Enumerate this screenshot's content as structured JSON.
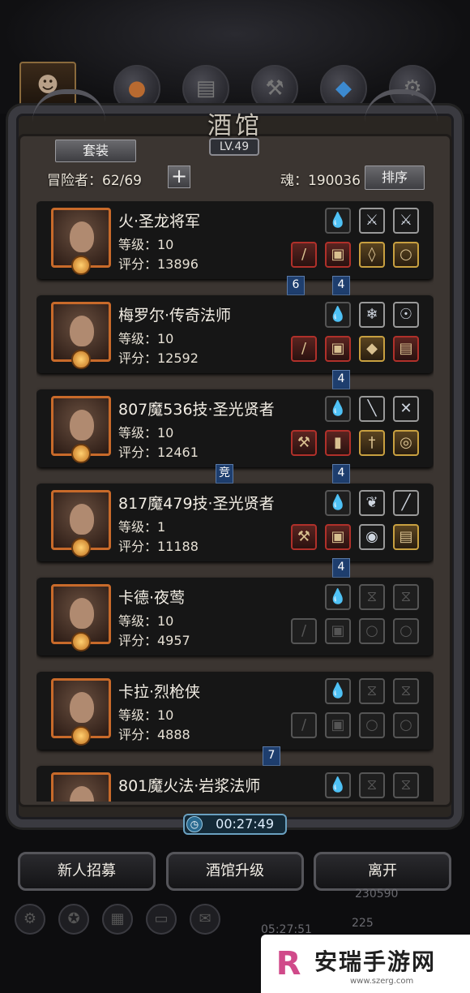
{
  "header": {
    "title": "酒馆",
    "level": "LV.49",
    "suit_button": "套装",
    "adventurers": "冒险者：62/69",
    "soul": "魂：190036",
    "sort_button": "排序"
  },
  "heroes": [
    {
      "name": "火·圣龙将军",
      "level": "等级：10",
      "score": "评分：13896"
    },
    {
      "name": "梅罗尔·传奇法师",
      "level": "等级：10",
      "score": "评分：12592"
    },
    {
      "name": "807魔536技·圣光贤者",
      "level": "等级：10",
      "score": "评分：12461"
    },
    {
      "name": "817魔479技·圣光贤者",
      "level": "等级：1",
      "score": "评分：11188"
    },
    {
      "name": "卡德·夜莺",
      "level": "等级：10",
      "score": "评分：4957"
    },
    {
      "name": "卡拉·烈枪侠",
      "level": "等级：10",
      "score": "评分：4888"
    },
    {
      "name": "801魔火法·岩浆法师",
      "level": "",
      "score": ""
    }
  ],
  "links": {
    "l1a": "6",
    "l1b": "4",
    "l2": "4",
    "l3a": "竞",
    "l3b": "4",
    "l4": "4",
    "l6": "7"
  },
  "timer": "00:27:49",
  "buttons": {
    "recruit": "新人招募",
    "upgrade": "酒馆升级",
    "leave": "离开"
  },
  "background": {
    "gold": "230590",
    "gems": "225",
    "clock": "05:27:51"
  },
  "watermark": {
    "text": "安瑞手游网",
    "url": "www.szerg.com"
  },
  "colors": {
    "frame": "#3a3a40",
    "portrait_border": "#c86a2a",
    "link_tag": "#1e3e6e",
    "timer": "#6aa0c0"
  }
}
